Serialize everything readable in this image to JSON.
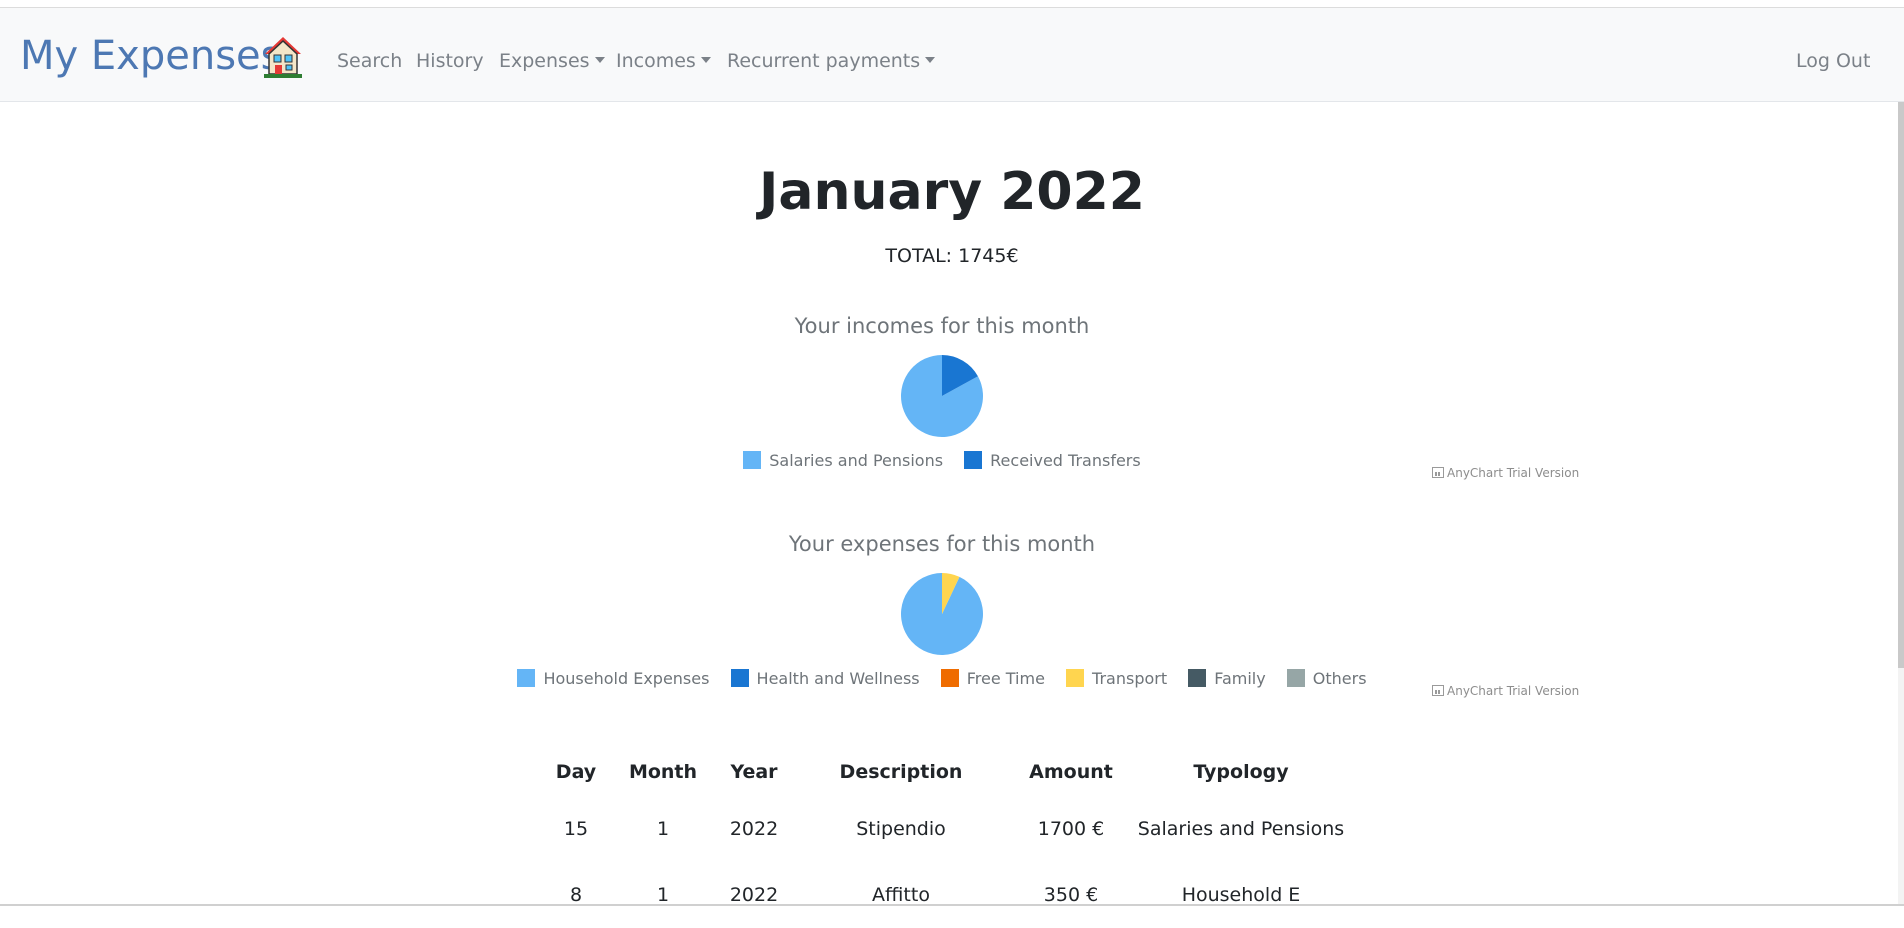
{
  "navbar": {
    "brand": "My Expenses",
    "links": {
      "search": "Search",
      "history": "History",
      "expenses": "Expenses",
      "incomes": "Incomes",
      "recurrent": "Recurrent payments",
      "logout": "Log Out"
    }
  },
  "page": {
    "title": "January 2022",
    "total": "TOTAL: 1745€"
  },
  "incomes_chart": {
    "title": "Your incomes for this month",
    "legend": [
      "Salaries and Pensions",
      "Received Transfers"
    ],
    "trial": "AnyChart Trial Version"
  },
  "expenses_chart": {
    "title": "Your expenses for this month",
    "legend": [
      "Household Expenses",
      "Health and Wellness",
      "Free Time",
      "Transport",
      "Family",
      "Others"
    ],
    "trial": "AnyChart Trial Version"
  },
  "chart_data": [
    {
      "type": "pie",
      "title": "Your incomes for this month",
      "categories": [
        "Salaries and Pensions",
        "Received Transfers"
      ],
      "values": [
        83,
        17
      ],
      "colors": [
        "#64b5f6",
        "#1976d2"
      ]
    },
    {
      "type": "pie",
      "title": "Your expenses for this month",
      "categories": [
        "Household Expenses",
        "Health and Wellness",
        "Free Time",
        "Transport",
        "Family",
        "Others"
      ],
      "values": [
        93,
        0,
        0,
        7,
        0,
        0
      ],
      "colors": [
        "#64b5f6",
        "#1976d2",
        "#ef6c00",
        "#ffd54f",
        "#455a64",
        "#96a6a6"
      ]
    }
  ],
  "table": {
    "headers": [
      "Day",
      "Month",
      "Year",
      "Description",
      "Amount",
      "Typology"
    ],
    "rows": [
      [
        "15",
        "1",
        "2022",
        "Stipendio",
        "1700 €",
        "Salaries and Pensions"
      ],
      [
        "8",
        "1",
        "2022",
        "Affitto",
        "350 €",
        "Household E"
      ]
    ]
  },
  "colors": {
    "brand": "#4d78b3",
    "navbar_bg": "#f8f9fa",
    "nav_text": "#7b8188"
  }
}
